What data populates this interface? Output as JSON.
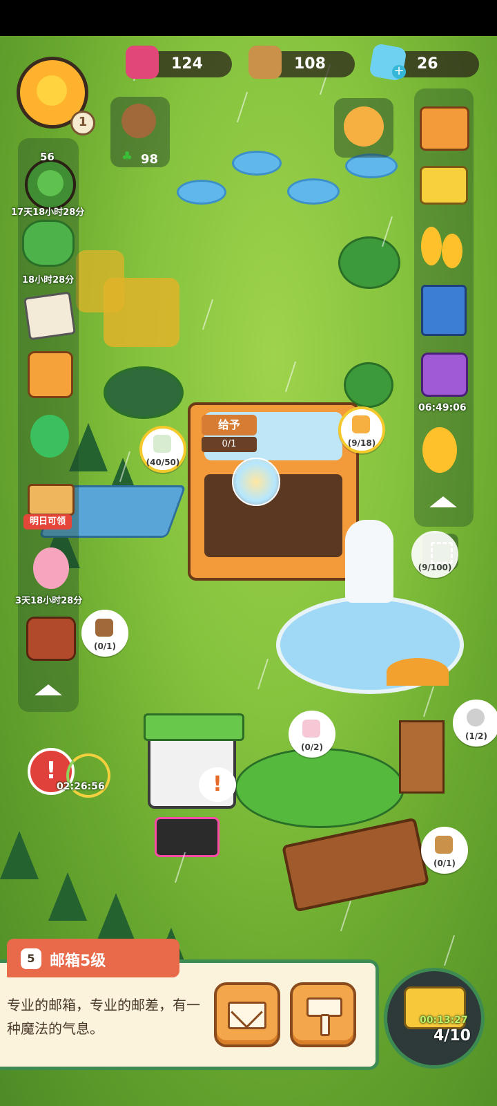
{
  "resources": {
    "jam": "124",
    "wood": "108",
    "gems": "26"
  },
  "player": {
    "level": "1"
  },
  "friends": {
    "clover_count": "98"
  },
  "left_sidebar": {
    "tree_level": "56",
    "tree_timer": "17天18小时28分",
    "bush_timer": "18小时28分",
    "building_label": "明日可领",
    "bear_timer": "3天18小时28分"
  },
  "right_sidebar": {
    "gift_timer": "06:49:06"
  },
  "shop": {
    "give_label": "给予",
    "give_progress": "0/1"
  },
  "bubbles": {
    "meter": "(40/50)",
    "fox": "(9/18)",
    "bear": "(0/1)",
    "photo": "(0/2)",
    "coin": "(1/2)",
    "crate": "(0/1)",
    "partial": "(9/100)"
  },
  "timers": {
    "alert_timer": "02:26:56"
  },
  "info_panel": {
    "level_badge": "5",
    "title": "邮箱5级",
    "description": "专业的邮箱，专业的邮差，有一种魔法的气息。"
  },
  "bus": {
    "timer": "00:13:27",
    "count": "4/10"
  },
  "colors": {
    "accent_orange": "#f3a64a",
    "panel_border": "#3d8b52",
    "tag_red": "#e96a4a",
    "timer_green": "#bff06a"
  },
  "icons": [
    "jam-icon",
    "log-icon",
    "diamond-icon",
    "plus-icon",
    "envelope-icon",
    "paint-roller-icon",
    "alert-icon",
    "fullscreen-icon",
    "chevron-up-icon"
  ]
}
